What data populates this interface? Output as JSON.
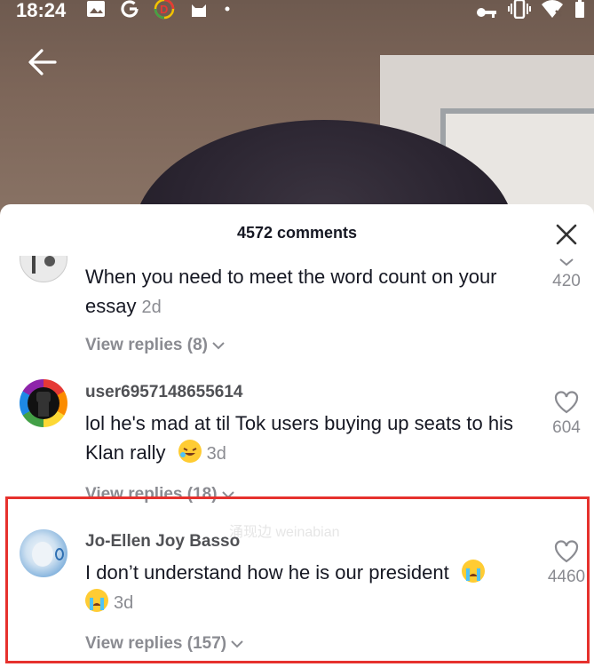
{
  "status_bar": {
    "time": "18:24",
    "left_icons": [
      "image-icon",
      "google-icon",
      "d-icon",
      "cat-icon",
      "dot-icon"
    ],
    "right_icons": [
      "key-icon",
      "vibrate-icon",
      "wifi-off-icon",
      "battery-icon"
    ]
  },
  "header": {
    "back_icon": "arrow-left-icon"
  },
  "sheet": {
    "title": "4572 comments",
    "close_icon": "close-icon"
  },
  "comments": [
    {
      "username": "",
      "text": "When you need to meet the word count on your essay",
      "date": "2d",
      "replies": "View replies (8)",
      "likes": "420"
    },
    {
      "username": "user6957148655614",
      "text": "lol he's mad at til Tok users buying up seats to his Klan rally",
      "emoji": "rolling-on-floor-laughing",
      "date": "3d",
      "replies": "View replies (18)",
      "likes": "604"
    },
    {
      "username": "Jo-Ellen Joy Basso",
      "text": "I don’t understand how he is our president",
      "emoji": "loudly-crying-face",
      "date": "3d",
      "replies": "View replies (157)",
      "likes": "4460"
    }
  ],
  "colors": {
    "highlight": "#e6312d",
    "secondary_text": "#8a8b91",
    "primary_text": "#161823"
  }
}
